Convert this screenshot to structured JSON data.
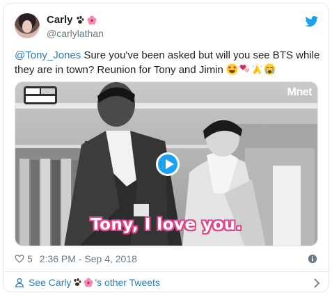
{
  "user": {
    "display_name": "Carly",
    "handle": "@carlylathan"
  },
  "tweet": {
    "mention": "@Tony_Jones",
    "text": " Sure you've been asked but will you see BTS while they are in town? Reunion for Tony and Jimin ",
    "emojis": [
      "heart-eyes-emoji",
      "two-hearts-emoji",
      "praying-hands-emoji",
      "crying-face-emoji"
    ]
  },
  "media": {
    "caption": "Tony, I love you.",
    "channel_logo": "Mnet",
    "play_icon": "play-icon"
  },
  "meta": {
    "likes": "5",
    "timestamp": "2:36 PM - Sep 4, 2018"
  },
  "footer": {
    "prefix": "See Carly",
    "suffix": "'s other Tweets"
  },
  "colors": {
    "link": "#2b7bb9",
    "muted": "#697882",
    "twitter_blue": "#1da1f2",
    "border": "#e1e8ed",
    "caption_outline": "#e0448b"
  }
}
